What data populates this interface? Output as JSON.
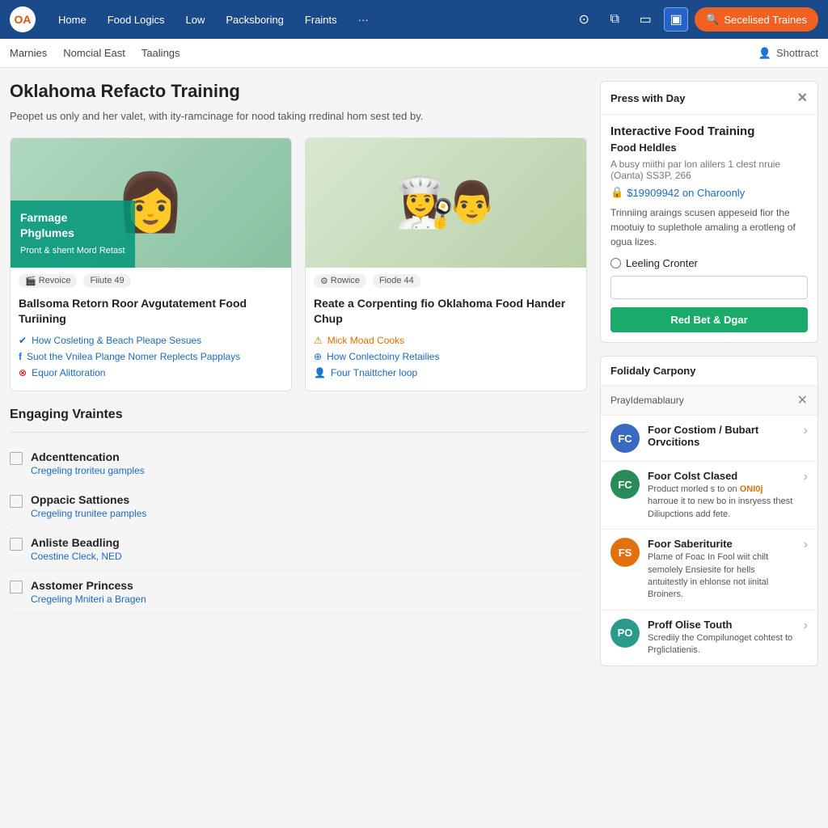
{
  "logo": {
    "text": "OA",
    "brand": "Food Logics"
  },
  "nav": {
    "links": [
      {
        "label": "Home"
      },
      {
        "label": "Food Logics"
      },
      {
        "label": "Low"
      },
      {
        "label": "Packsboring"
      },
      {
        "label": "Fraints"
      },
      {
        "label": "···"
      }
    ],
    "icons": [
      "⊙",
      "⧉",
      "▭",
      "▣"
    ],
    "search_btn": "Secelised Traines"
  },
  "secondary_nav": {
    "links": [
      "Marnies",
      "Nomcial East",
      "Taalings"
    ],
    "right": "Shottract"
  },
  "page": {
    "title": "Oklahoma Refacto Training",
    "subtitle": "Peopet us only and her valet, with ity-ramcinage for nood taking rredinal hom sest ted by."
  },
  "cards": [
    {
      "overlay_title": "Farmage\nPhglumes",
      "overlay_sub": "Pront & shent\nMord Retast",
      "badge1": "Revoice",
      "badge2": "Fiiute 49",
      "title": "Ballsoma Retorn Roor Avgutatement Food Turiining",
      "links": [
        {
          "icon": "✓",
          "text": "How Cosleting & Beach Pleape Sesues",
          "type": "normal"
        },
        {
          "icon": "f",
          "text": "Suot the Vnilea Plange Nomer Replects Papplays",
          "type": "normal"
        },
        {
          "icon": "⊗",
          "text": "Equor Alittoration",
          "type": "normal"
        }
      ]
    },
    {
      "badge1": "Rowice",
      "badge2": "Fiode 44",
      "title": "Reate a Corpenting fio Oklahoma Food Hander Chup",
      "links": [
        {
          "icon": "⚠",
          "text": "Mick Moad Cooks",
          "type": "warn"
        },
        {
          "icon": "⊕",
          "text": "How Conlectoiny Retailies",
          "type": "normal"
        },
        {
          "icon": "👤",
          "text": "Four Tnaittcher loop",
          "type": "normal"
        }
      ]
    }
  ],
  "engaging": {
    "section_title": "Engaging Vraintes",
    "items": [
      {
        "title": "Adcenttencation",
        "sub": "Cregeling troriteu gamples"
      },
      {
        "title": "Oppacic Sattiones",
        "sub": "Cregeling trunitee pamples"
      },
      {
        "title": "Anliste Beadling",
        "sub": "Coestine Cleck, NED"
      },
      {
        "title": "Asstomer Princess",
        "sub": "Cregeling Mniteri a Bragen"
      }
    ]
  },
  "right_panel": {
    "header": "Press with Day",
    "main_title": "Interactive Food Training",
    "subtitle": "Food Heldles",
    "desc_small": "A busy miithi par lon alilers 1 clest nruie (Oanta) SS3P, 266",
    "price": "$19909942 on Charoonly",
    "training_desc": "Trinniing araings scusen appeseid fior the mootuiy to suplethole amaling a erotleng of ogua lizes.",
    "radio_label": "Leeling Cronter",
    "input_placeholder": "",
    "btn_label": "Red Bet & Dgar"
  },
  "sidebar_panel": {
    "title": "Folidaly Carpony",
    "subheader": "PrayIdemablaury",
    "profiles": [
      {
        "initials": "FC",
        "color": "blue",
        "name": "Foor Costiom / Bubart Orvcitions",
        "desc": ""
      },
      {
        "initials": "FC",
        "color": "green",
        "name": "Foor Colst Clased",
        "desc": "Product morled s to on ONI0j harroue it to new bo in insryess thest Diliupctions add fete.",
        "highlight": "ONI0j"
      },
      {
        "initials": "FS",
        "color": "orange",
        "name": "Foor Saberiturite",
        "desc": "Plame of Foac In Fool wiit chilt semolely Ensiesite for hells antuitestly in ehlonse not iinital Broiners."
      },
      {
        "initials": "PO",
        "color": "teal",
        "name": "Proff Olise Touth",
        "desc": "Scrediiy the Compilunoget cohtest to Prgliclatienis."
      }
    ]
  }
}
